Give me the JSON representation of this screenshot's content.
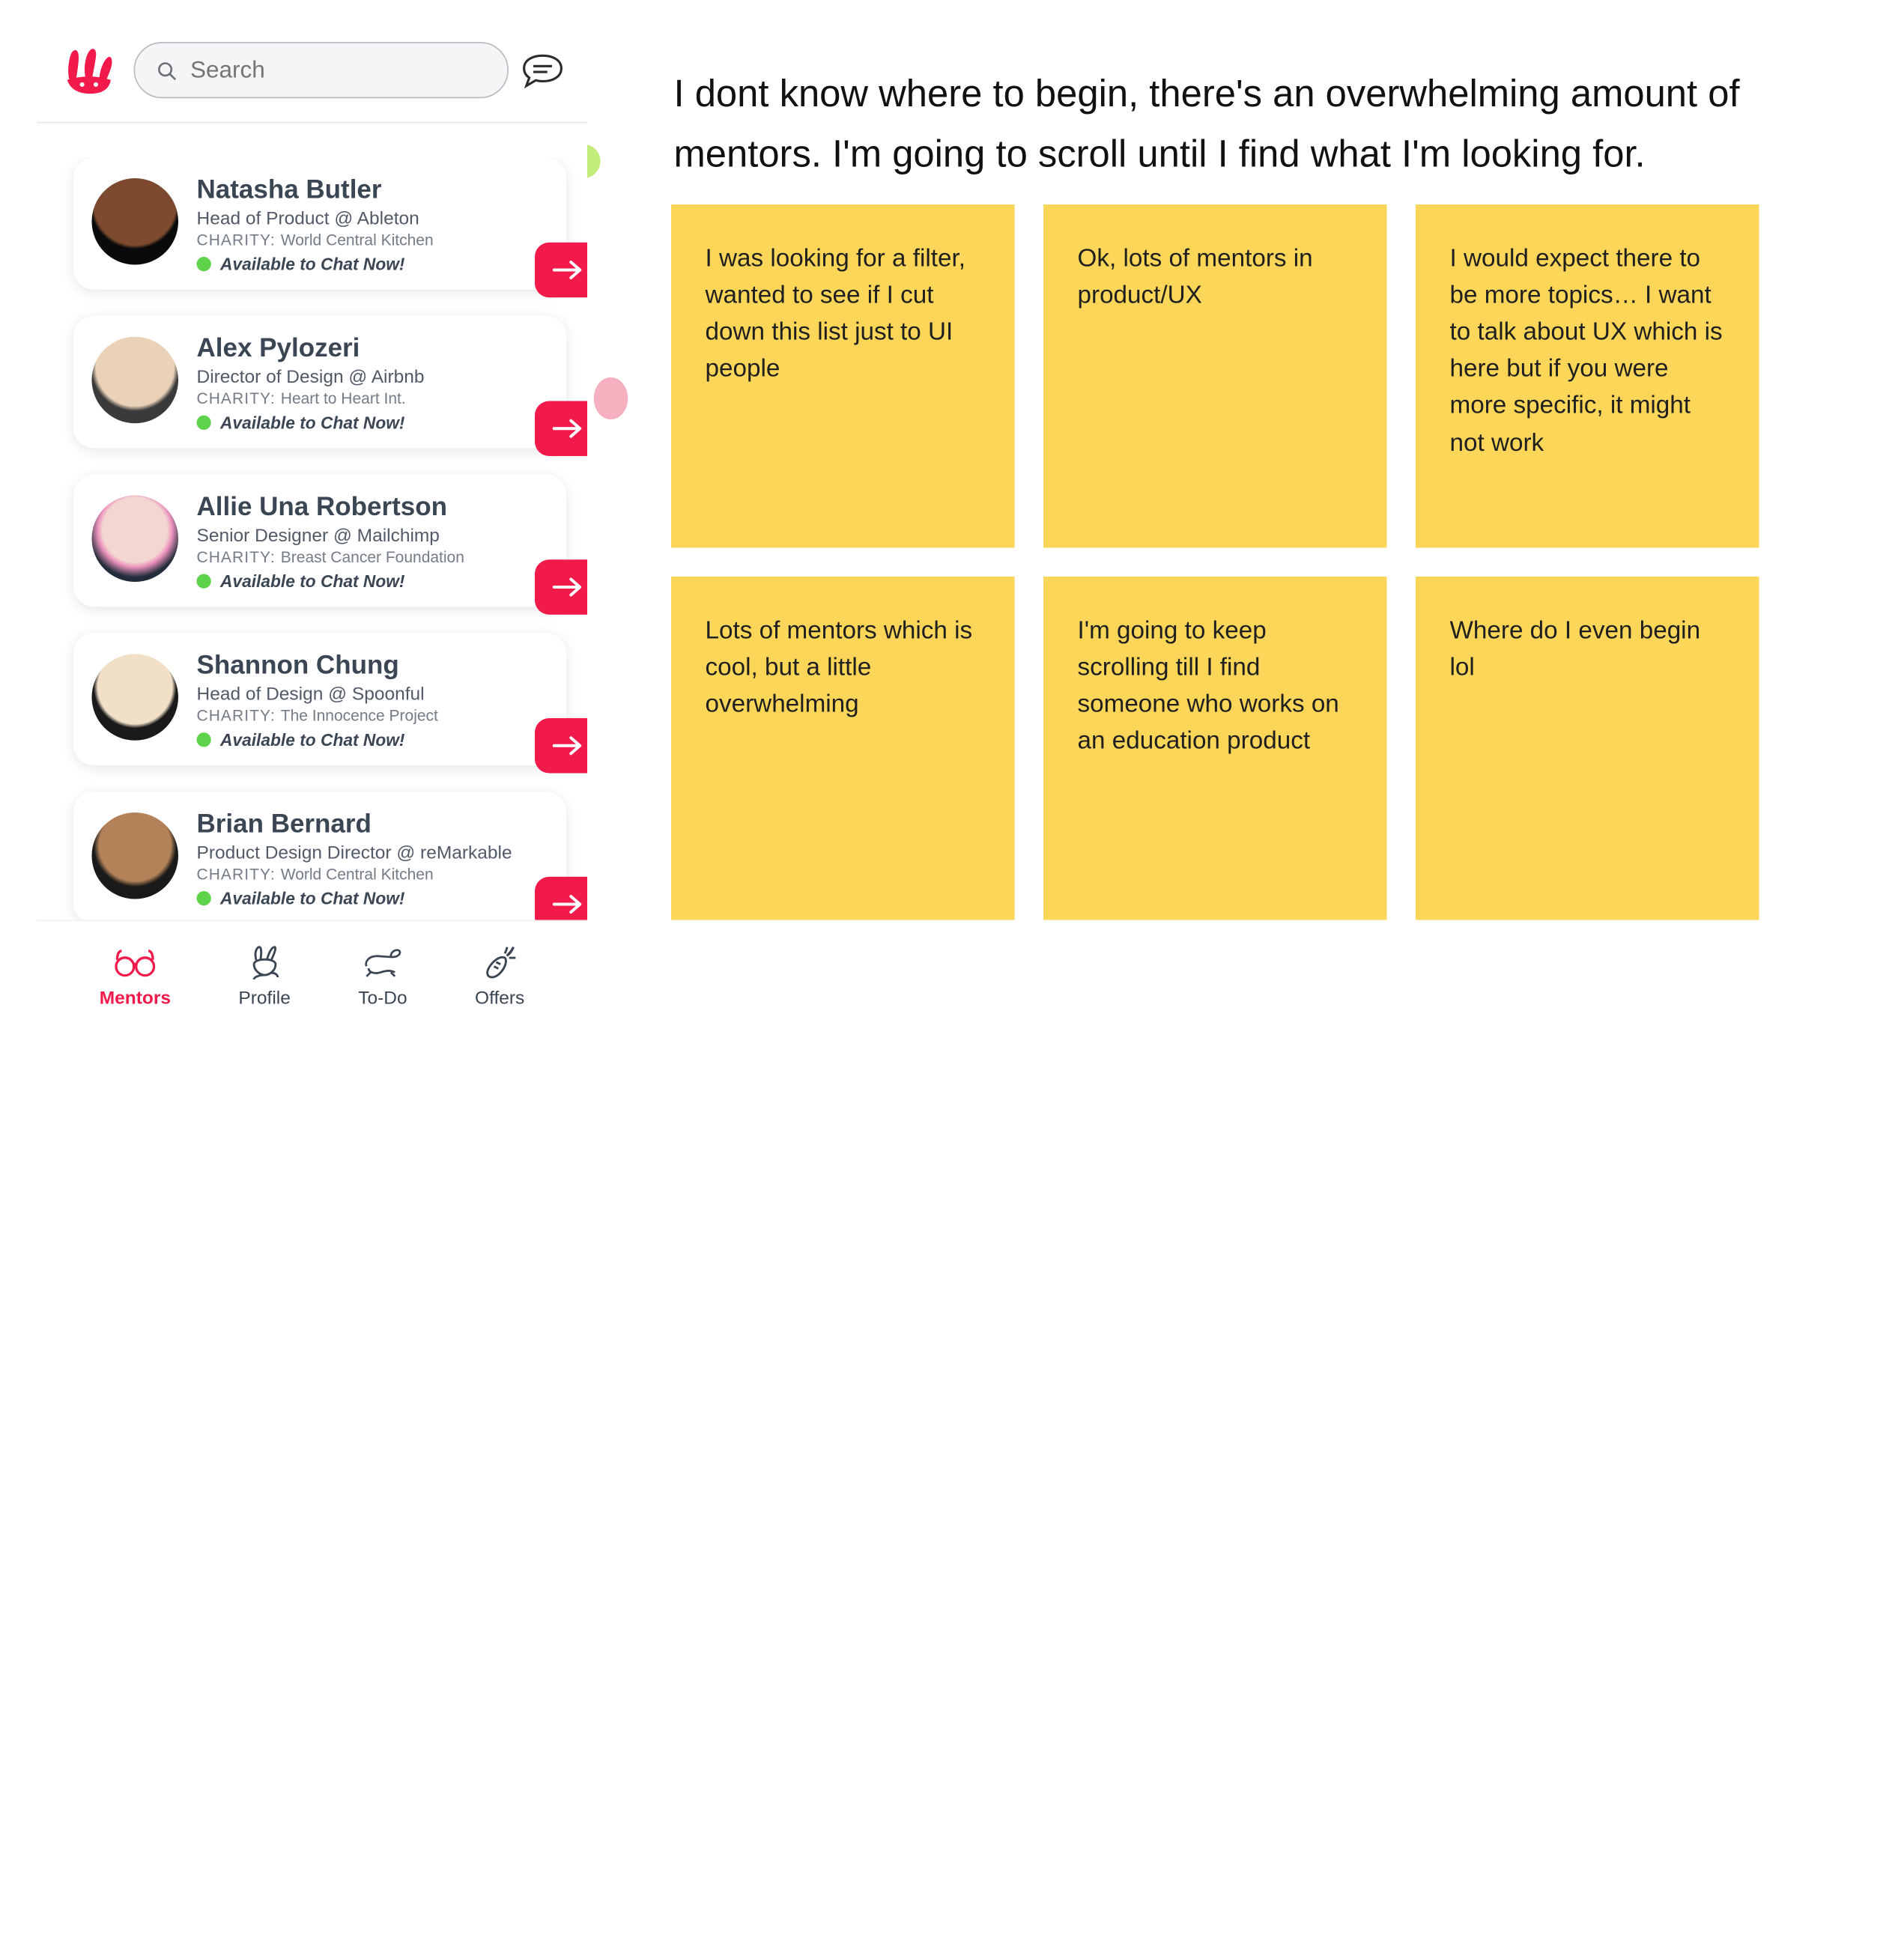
{
  "search_placeholder": "Search",
  "charity_label": "CHARITY:",
  "available_text": "Available to Chat Now!",
  "mentors": [
    {
      "name": "Natasha Butler",
      "title": "Head of Product @ Ableton",
      "charity": "World Central Kitchen"
    },
    {
      "name": "Alex Pylozeri",
      "title": "Director of Design @ Airbnb",
      "charity": "Heart to Heart Int."
    },
    {
      "name": "Allie Una Robertson",
      "title": "Senior Designer @ Mailchimp",
      "charity": "Breast Cancer Foundation"
    },
    {
      "name": "Shannon Chung",
      "title": "Head of Design @ Spoonful",
      "charity": "The Innocence Project"
    },
    {
      "name": "Brian Bernard",
      "title": "Product Design Director @ reMarkable",
      "charity": "World Central Kitchen"
    }
  ],
  "nav": {
    "mentors": "Mentors",
    "profile": "Profile",
    "todo": "To-Do",
    "offers": "Offers"
  },
  "observation_headline": "I dont know where to begin, there's an overwhelming amount of mentors. I'm going to scroll until I find what I'm looking for.",
  "notes": [
    "I was looking for a filter, wanted to see if I cut down this list just to UI people",
    "Ok, lots of mentors in product/UX",
    "I would expect there to be more topics… I want to talk about UX which is here but if you were more specific, it might not work",
    "Lots of mentors which is cool, but a little overwhelming",
    "I'm going to keep scrolling till I find someone who works on an education product",
    "Where do I even begin lol"
  ]
}
